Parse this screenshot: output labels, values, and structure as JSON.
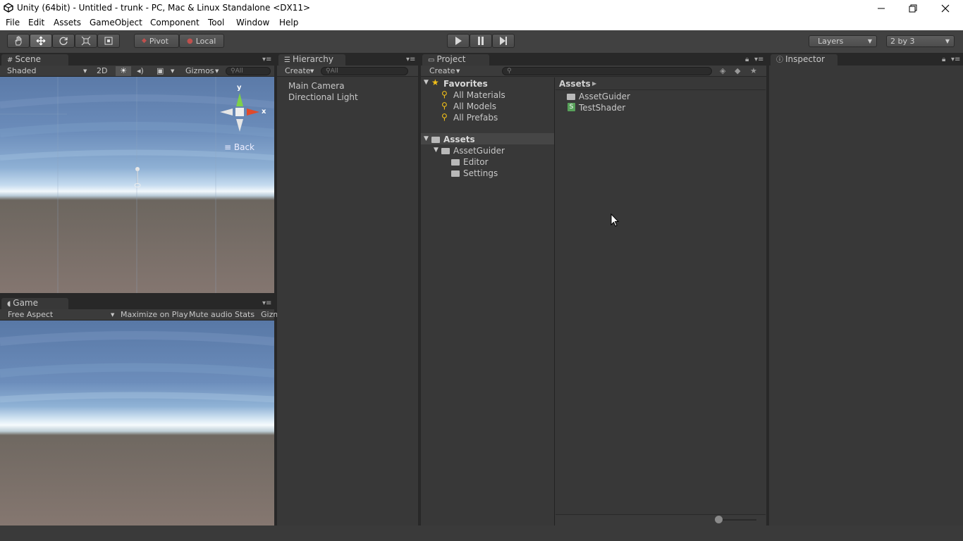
{
  "window": {
    "title": "Unity (64bit) - Untitled - trunk - PC, Mac & Linux Standalone <DX11>",
    "controls": {
      "minimize": "—",
      "maximize": "❐",
      "close": "✕"
    }
  },
  "menu": [
    "File",
    "Edit",
    "Assets",
    "GameObject",
    "Component",
    "Tool",
    "Window",
    "Help"
  ],
  "toolbar": {
    "pivot_label": "Pivot",
    "local_label": "Local",
    "layers_label": "Layers",
    "layout_label": "2 by 3"
  },
  "scene": {
    "tab": "Scene",
    "shading": "Shaded",
    "mode_2d": "2D",
    "gizmos": "Gizmos",
    "search_placeholder": "All",
    "gizmo_y": "y",
    "gizmo_x": "x",
    "view_label": "Back"
  },
  "game": {
    "tab": "Game",
    "aspect": "Free Aspect",
    "maximize": "Maximize on Play",
    "mute": "Mute audio",
    "stats": "Stats",
    "gizmos": "Gizm"
  },
  "hierarchy": {
    "tab": "Hierarchy",
    "create": "Create",
    "search_placeholder": "All",
    "items": [
      "Main Camera",
      "Directional Light"
    ]
  },
  "project": {
    "tab": "Project",
    "create": "Create",
    "favorites_label": "Favorites",
    "favorites": [
      "All Materials",
      "All Models",
      "All Prefabs"
    ],
    "assets_label": "Assets",
    "asset_tree": {
      "folder": "AssetGuider",
      "children": [
        "Editor",
        "Settings"
      ]
    },
    "breadcrumb": "Assets",
    "contents": [
      {
        "name": "AssetGuider",
        "icon": "folder-icon"
      },
      {
        "name": "TestShader",
        "icon": "shader-icon"
      }
    ]
  },
  "inspector": {
    "tab": "Inspector"
  },
  "colors": {
    "accent": "#3e5f96",
    "panel": "#383838",
    "dark": "#282828"
  }
}
